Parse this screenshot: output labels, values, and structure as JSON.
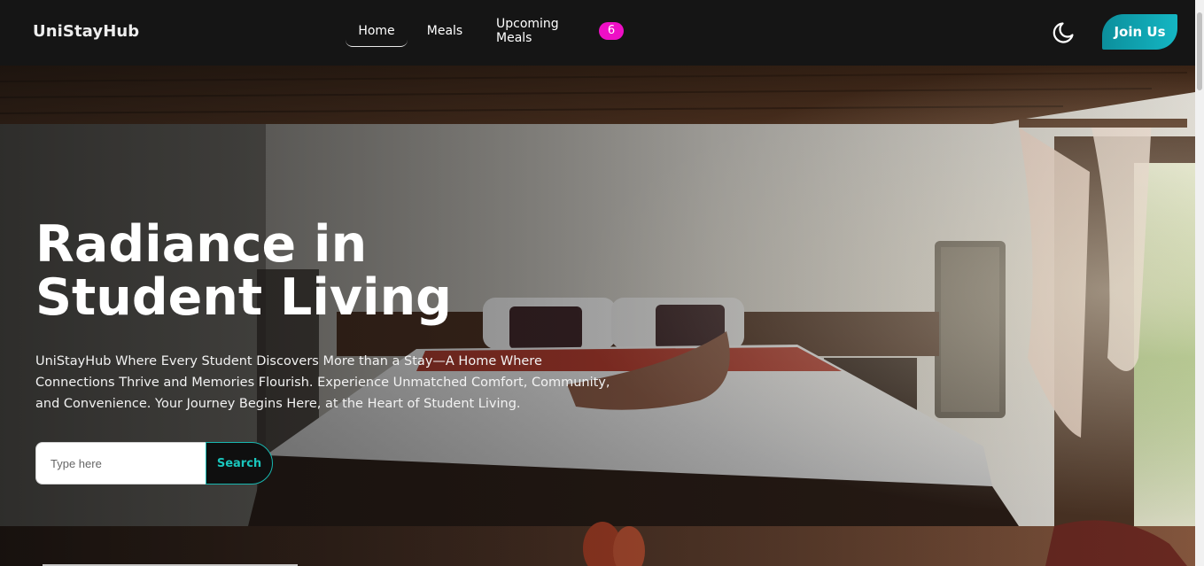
{
  "brand": {
    "name": "UniStayHub"
  },
  "nav": {
    "home": "Home",
    "meals": "Meals",
    "upcoming_meals": "Upcoming Meals",
    "upcoming_count": "6",
    "theme_icon": "moon-icon",
    "join_label": "Join Us"
  },
  "hero": {
    "title": "Radiance in Student Living",
    "description": "UniStayHub Where Every Student Discovers More than a Stay—A Home Where Connections Thrive and Memories Flourish. Experience Unmatched Comfort, Community, and Convenience. Your Journey Begins Here, at the Heart of Student Living.",
    "background": "bedroom-photo"
  },
  "search": {
    "placeholder": "Type here",
    "button_label": "Search"
  },
  "colors": {
    "background": "#151515",
    "accent": "#14b6c3",
    "badge": "#ee0fc6",
    "search_text": "#1ac6bd"
  }
}
